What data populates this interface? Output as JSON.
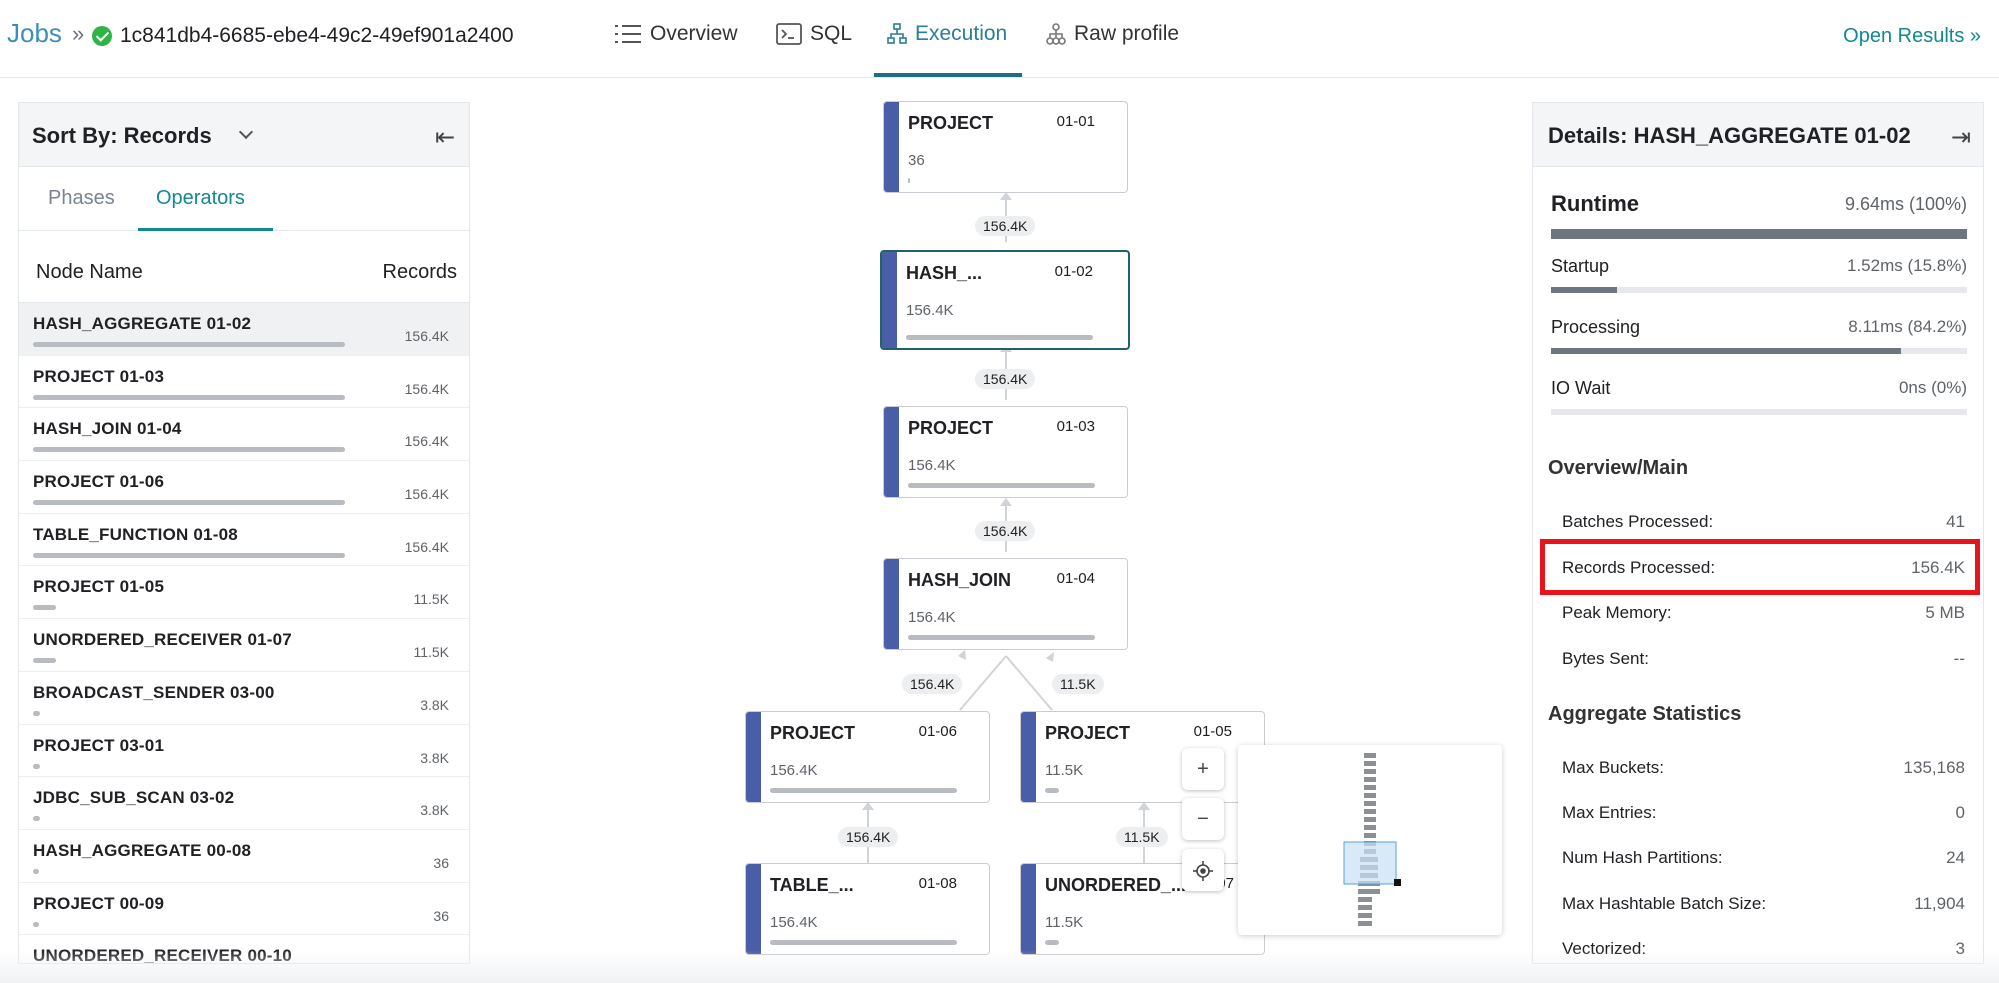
{
  "header": {
    "jobs_label": "Jobs",
    "separator": "»",
    "job_id": "1c841db4-6685-ebe4-49c2-49ef901a2400",
    "status_color": "#2fb344",
    "tabs": [
      {
        "label": "Overview",
        "icon": "list-icon"
      },
      {
        "label": "SQL",
        "icon": "terminal-icon"
      },
      {
        "label": "Execution",
        "icon": "execution-tree-icon",
        "active": true
      },
      {
        "label": "Raw profile",
        "icon": "hierarchy-icon"
      }
    ],
    "open_results": "Open Results »"
  },
  "left_panel": {
    "sort_by": "Sort By: Records",
    "tabs": [
      {
        "label": "Phases"
      },
      {
        "label": "Operators",
        "active": true
      }
    ],
    "col_name": "Node Name",
    "col_records": "Records",
    "rows": [
      {
        "name": "HASH_AGGREGATE 01-02",
        "records": "156.4K",
        "fraction": 1.0,
        "selected": true
      },
      {
        "name": "PROJECT 01-03",
        "records": "156.4K",
        "fraction": 1.0
      },
      {
        "name": "HASH_JOIN 01-04",
        "records": "156.4K",
        "fraction": 1.0
      },
      {
        "name": "PROJECT 01-06",
        "records": "156.4K",
        "fraction": 1.0
      },
      {
        "name": "TABLE_FUNCTION 01-08",
        "records": "156.4K",
        "fraction": 1.0
      },
      {
        "name": "PROJECT 01-05",
        "records": "11.5K",
        "fraction": 0.074
      },
      {
        "name": "UNORDERED_RECEIVER 01-07",
        "records": "11.5K",
        "fraction": 0.074
      },
      {
        "name": "BROADCAST_SENDER 03-00",
        "records": "3.8K",
        "fraction": 0.024
      },
      {
        "name": "PROJECT 03-01",
        "records": "3.8K",
        "fraction": 0.024
      },
      {
        "name": "JDBC_SUB_SCAN 03-02",
        "records": "3.8K",
        "fraction": 0.024
      },
      {
        "name": "HASH_AGGREGATE 00-08",
        "records": "36",
        "fraction": 0.0
      },
      {
        "name": "PROJECT 00-09",
        "records": "36",
        "fraction": 0.0
      },
      {
        "name": "UNORDERED_RECEIVER 00-10",
        "records": "",
        "fraction": 0.0
      }
    ]
  },
  "graph": {
    "nodes": [
      {
        "title": "PROJECT",
        "id": "01-01",
        "value": "36",
        "fraction": 0.0
      },
      {
        "title": "HASH_...",
        "id": "01-02",
        "value": "156.4K",
        "fraction": 1.0,
        "selected": true
      },
      {
        "title": "PROJECT",
        "id": "01-03",
        "value": "156.4K",
        "fraction": 1.0
      },
      {
        "title": "HASH_JOIN",
        "id": "01-04",
        "value": "156.4K",
        "fraction": 1.0
      },
      {
        "title": "PROJECT",
        "id": "01-06",
        "value": "156.4K",
        "fraction": 1.0
      },
      {
        "title": "PROJECT",
        "id": "01-05",
        "value": "11.5K",
        "fraction": 0.074
      },
      {
        "title": "TABLE_...",
        "id": "01-08",
        "value": "156.4K",
        "fraction": 1.0
      },
      {
        "title": "UNORDERED_...",
        "id": "01-07",
        "value": "11.5K",
        "fraction": 0.074
      }
    ],
    "edges": [
      "156.4K",
      "156.4K",
      "156.4K",
      "156.4K",
      "11.5K",
      "156.4K",
      "11.5K"
    ],
    "zoom_in": "+",
    "zoom_out": "−"
  },
  "details": {
    "title": "Details: HASH_AGGREGATE 01-02",
    "runtime_label": "Runtime",
    "runtime_value": "9.64ms (100%)",
    "metrics": [
      {
        "label": "Startup",
        "value": "1.52ms (15.8%)",
        "fraction": 0.158
      },
      {
        "label": "Processing",
        "value": "8.11ms (84.2%)",
        "fraction": 0.842
      },
      {
        "label": "IO Wait",
        "value": "0ns (0%)",
        "fraction": 0.0
      }
    ],
    "overview_title": "Overview/Main",
    "overview": [
      {
        "label": "Batches Processed:",
        "value": "41"
      },
      {
        "label": "Records Processed:",
        "value": "156.4K"
      },
      {
        "label": "Peak Memory:",
        "value": "5 MB"
      },
      {
        "label": "Bytes Sent:",
        "value": "--"
      }
    ],
    "aggregate_title": "Aggregate Statistics",
    "aggregate": [
      {
        "label": "Max Buckets:",
        "value": "135,168"
      },
      {
        "label": "Max Entries:",
        "value": "0"
      },
      {
        "label": "Num Hash Partitions:",
        "value": "24"
      },
      {
        "label": "Max Hashtable Batch Size:",
        "value": "11,904"
      },
      {
        "label": "Vectorized:",
        "value": "3"
      }
    ]
  }
}
